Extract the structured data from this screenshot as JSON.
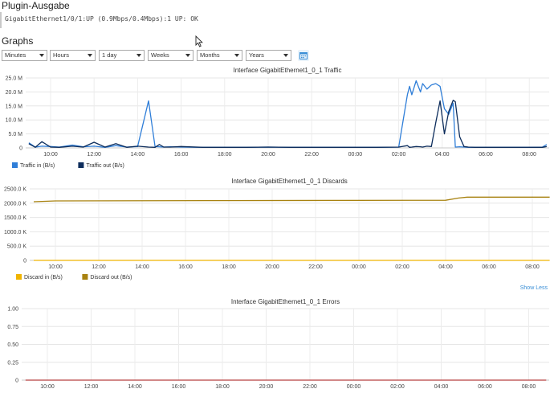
{
  "plugin": {
    "title": "Plugin-Ausgabe",
    "output": "GigabitEthernet1/0/1:UP (0.9Mbps/0.4Mbps):1 UP: OK"
  },
  "graphs": {
    "title": "Graphs",
    "show_less": "Show Less",
    "controls": [
      {
        "name": "minutes-select",
        "value": "Minutes"
      },
      {
        "name": "hours-select",
        "value": "Hours"
      },
      {
        "name": "range-select",
        "value": "1 day"
      },
      {
        "name": "weeks-select",
        "value": "Weeks"
      },
      {
        "name": "months-select",
        "value": "Months"
      },
      {
        "name": "years-select",
        "value": "Years"
      }
    ],
    "calendar_icon": "calendar-icon"
  },
  "chart_data": [
    {
      "type": "line",
      "title": "Interface GigabitEthernet1_0_1 Traffic",
      "ylim": [
        0,
        25000000
      ],
      "y_ticks": [
        "0",
        "5.0 M",
        "10.0 M",
        "15.0 M",
        "20.0 M",
        "25.0 M"
      ],
      "x_ticks": [
        "10:00",
        "12:00",
        "14:00",
        "16:00",
        "18:00",
        "20:00",
        "22:00",
        "00:00",
        "02:00",
        "04:00",
        "06:00",
        "08:00"
      ],
      "x": [
        0,
        0.3,
        0.6,
        1.0,
        1.4,
        2.0,
        2.5,
        3.0,
        3.5,
        4.0,
        4.5,
        5.0,
        5.5,
        5.8,
        6.0,
        6.2,
        6.5,
        7.0,
        8.0,
        9.0,
        10.0,
        11.0,
        12.0,
        13.0,
        14.0,
        15.0,
        16.0,
        17.0,
        17.4,
        17.5,
        17.6,
        17.8,
        18.0,
        18.1,
        18.3,
        18.5,
        18.7,
        18.9,
        19.1,
        19.3,
        19.5,
        19.6,
        19.8,
        20.0,
        20.2,
        20.5,
        21.0,
        22.0,
        23.0,
        23.6,
        23.8
      ],
      "series": [
        {
          "name": "Traffic in (B/s)",
          "color": "#2f7ed8",
          "values": [
            1800000,
            300000,
            600000,
            500000,
            300000,
            1000000,
            400000,
            600000,
            200000,
            800000,
            300000,
            500000,
            16800000,
            500000,
            400000,
            300000,
            400000,
            300000,
            200000,
            200000,
            200000,
            300000,
            200000,
            200000,
            200000,
            200000,
            200000,
            300000,
            19000000,
            22000000,
            19000000,
            24000000,
            20000000,
            23000000,
            21000000,
            22500000,
            23000000,
            22000000,
            14000000,
            12000000,
            16000000,
            300000,
            400000,
            300000,
            200000,
            200000,
            200000,
            200000,
            200000,
            300000,
            1200000
          ]
        },
        {
          "name": "Traffic out (B/s)",
          "color": "#0d2d5c",
          "values": [
            1500000,
            200000,
            2200000,
            300000,
            200000,
            600000,
            300000,
            2000000,
            300000,
            1500000,
            200000,
            600000,
            300000,
            200000,
            1200000,
            300000,
            300000,
            500000,
            200000,
            200000,
            200000,
            300000,
            200000,
            200000,
            200000,
            200000,
            200000,
            300000,
            800000,
            200000,
            300000,
            500000,
            400000,
            300000,
            600000,
            500000,
            9000000,
            16800000,
            5000000,
            13000000,
            17000000,
            16500000,
            4000000,
            500000,
            300000,
            200000,
            200000,
            200000,
            200000,
            200000,
            500000
          ]
        }
      ]
    },
    {
      "type": "line",
      "title": "Interface GigabitEthernet1_0_1 Discards",
      "ylim": [
        0,
        2500000
      ],
      "y_ticks": [
        "0",
        "500.0 K",
        "1000.0 K",
        "1500.0 K",
        "2000.0 K",
        "2500.0 K"
      ],
      "x_ticks": [
        "10:00",
        "12:00",
        "14:00",
        "16:00",
        "18:00",
        "20:00",
        "22:00",
        "00:00",
        "02:00",
        "04:00",
        "06:00",
        "08:00"
      ],
      "x": [
        0,
        1,
        8,
        19.0,
        19.6,
        20.0,
        23.8
      ],
      "series": [
        {
          "name": "Discard in (B/s)",
          "color": "#f0b400",
          "values": [
            0,
            0,
            0,
            0,
            0,
            0,
            0
          ]
        },
        {
          "name": "Discard out (B/s)",
          "color": "#a88210",
          "values": [
            2050000,
            2080000,
            2090000,
            2100000,
            2180000,
            2210000,
            2210000
          ]
        }
      ]
    },
    {
      "type": "line",
      "title": "Interface GigabitEthernet1_0_1 Errors",
      "ylim": [
        0,
        1
      ],
      "y_ticks": [
        "0",
        "0.25",
        "0.50",
        "0.75",
        "1.00"
      ],
      "x_ticks": [
        "10:00",
        "12:00",
        "14:00",
        "16:00",
        "18:00",
        "20:00",
        "22:00",
        "00:00",
        "02:00",
        "04:00",
        "06:00",
        "08:00"
      ],
      "x": [
        0,
        23.8
      ],
      "series": [
        {
          "name": "",
          "color": "#b84040",
          "values": [
            0,
            0
          ]
        }
      ]
    }
  ]
}
